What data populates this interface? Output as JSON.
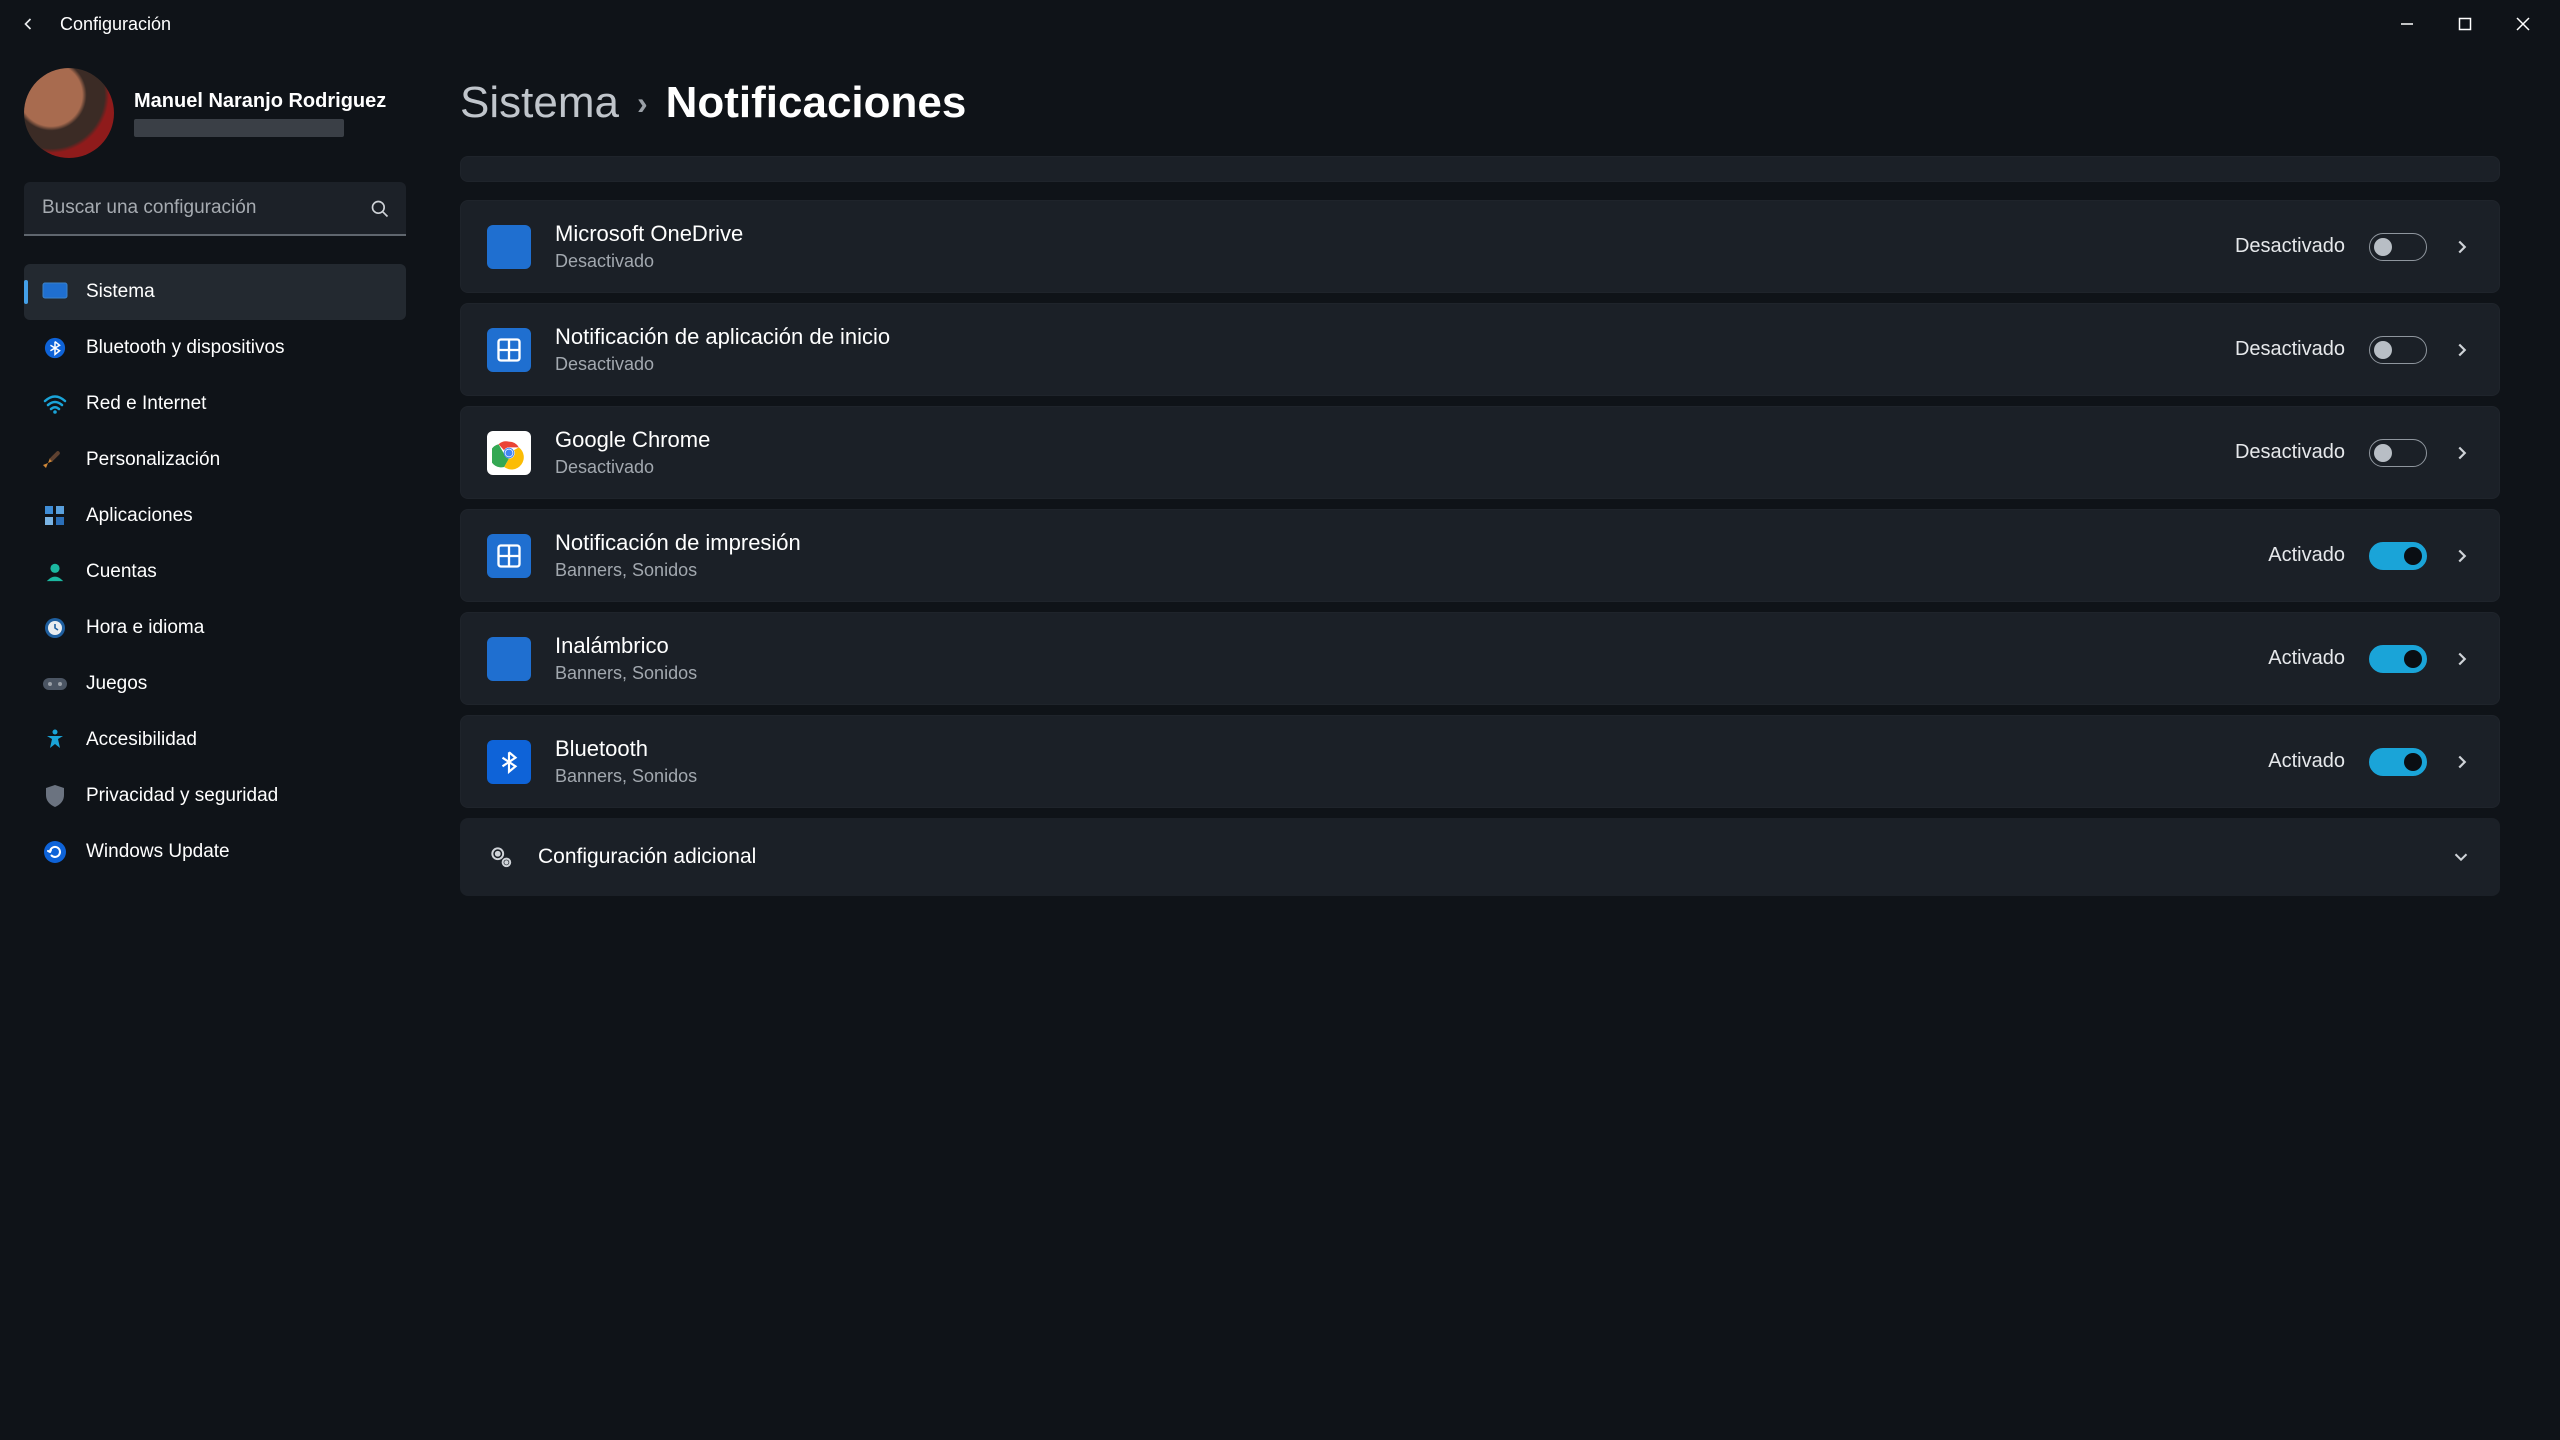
{
  "window": {
    "title": "Configuración"
  },
  "user": {
    "name": "Manuel Naranjo Rodriguez"
  },
  "search": {
    "placeholder": "Buscar una configuración"
  },
  "nav": [
    {
      "key": "sistema",
      "label": "Sistema",
      "active": true
    },
    {
      "key": "bluetooth",
      "label": "Bluetooth y dispositivos"
    },
    {
      "key": "red",
      "label": "Red e Internet"
    },
    {
      "key": "personalizacion",
      "label": "Personalización"
    },
    {
      "key": "aplicaciones",
      "label": "Aplicaciones"
    },
    {
      "key": "cuentas",
      "label": "Cuentas"
    },
    {
      "key": "hora",
      "label": "Hora e idioma"
    },
    {
      "key": "juegos",
      "label": "Juegos"
    },
    {
      "key": "accesibilidad",
      "label": "Accesibilidad"
    },
    {
      "key": "privacidad",
      "label": "Privacidad y seguridad"
    },
    {
      "key": "update",
      "label": "Windows Update"
    }
  ],
  "breadcrumb": {
    "parent": "Sistema",
    "current": "Notificaciones"
  },
  "state_labels": {
    "on": "Activado",
    "off": "Desactivado"
  },
  "apps": [
    {
      "name": "Microsoft OneDrive",
      "sub": "Desactivado",
      "on": false,
      "icon": "onedrive"
    },
    {
      "name": "Notificación de aplicación de inicio",
      "sub": "Desactivado",
      "on": false,
      "icon": "tile"
    },
    {
      "name": "Google Chrome",
      "sub": "Desactivado",
      "on": false,
      "icon": "chrome"
    },
    {
      "name": "Notificación de impresión",
      "sub": "Banners, Sonidos",
      "on": true,
      "icon": "tile"
    },
    {
      "name": "Inalámbrico",
      "sub": "Banners, Sonidos",
      "on": true,
      "icon": "wireless"
    },
    {
      "name": "Bluetooth",
      "sub": "Banners, Sonidos",
      "on": true,
      "icon": "bluetooth"
    }
  ],
  "extra": {
    "label": "Configuración adicional"
  }
}
